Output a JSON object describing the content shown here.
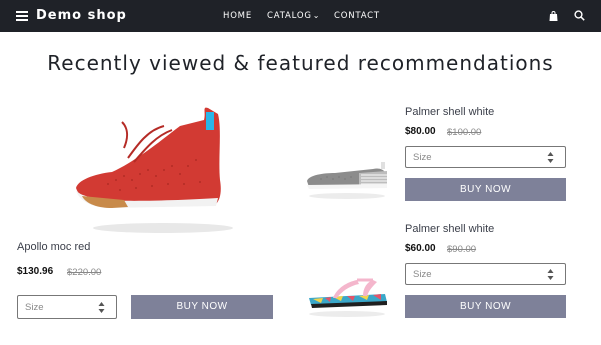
{
  "header": {
    "brand": "Demo shop",
    "nav": {
      "home": "HOME",
      "catalog": "CATALOG",
      "contact": "CONTACT"
    },
    "icons": {
      "menu": "hamburger-icon",
      "cart": "shopping-bag-icon",
      "search": "search-icon"
    }
  },
  "page_title": "Recently viewed & featured recommendations",
  "products": [
    {
      "name": "Apollo moc red",
      "price": "$130.96",
      "old_price": "$220.00",
      "size_placeholder": "Size",
      "button": "BUY NOW",
      "image": "red-sneaker"
    },
    {
      "name": "Palmer shell white",
      "price": "$80.00",
      "old_price": "$100.00",
      "size_placeholder": "Size",
      "button": "BUY NOW",
      "image": "grey-striped-slip-on"
    },
    {
      "name": "Palmer shell white",
      "price": "$60.00",
      "old_price": "$90.00",
      "size_placeholder": "Size",
      "button": "BUY NOW",
      "image": "pink-floral-sandal"
    }
  ],
  "colors": {
    "header_bg": "#1f2228",
    "button_bg": "#7e8199",
    "product_red": "#d23a33"
  }
}
